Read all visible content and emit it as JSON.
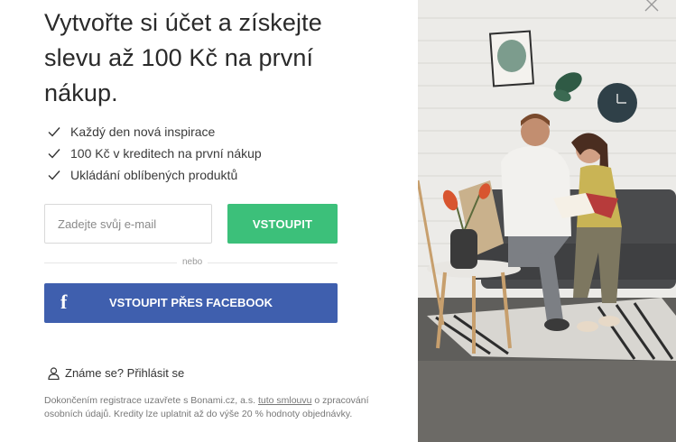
{
  "modal": {
    "title": "Vytvořte si účet a získejte slevu až 100 Kč na první nákup.",
    "benefits": [
      "Každý den nová inspirace",
      "100 Kč v kreditech na první nákup",
      "Ukládání oblíbených produktů"
    ],
    "email": {
      "placeholder": "Zadejte svůj e-mail",
      "value": ""
    },
    "submit_label": "VSTOUPIT",
    "or_label": "nebo",
    "facebook": {
      "icon": "f",
      "label": "VSTOUPIT PŘES FACEBOOK"
    },
    "login_label": "Známe se? Přihlásit se",
    "legal": {
      "before": "Dokončením registrace uzavřete s Bonami.cz, a.s. ",
      "link": "tuto smlouvu",
      "after": " o zpracování osobních údajů. Kredity lze uplatnit až do výše 20 % hodnoty objednávky."
    }
  },
  "colors": {
    "accent_green": "#3cc07a",
    "facebook_blue": "#3f5fae"
  },
  "icons": {
    "check": "check-icon",
    "user": "user-icon",
    "close": "close-icon",
    "facebook": "facebook-icon"
  }
}
